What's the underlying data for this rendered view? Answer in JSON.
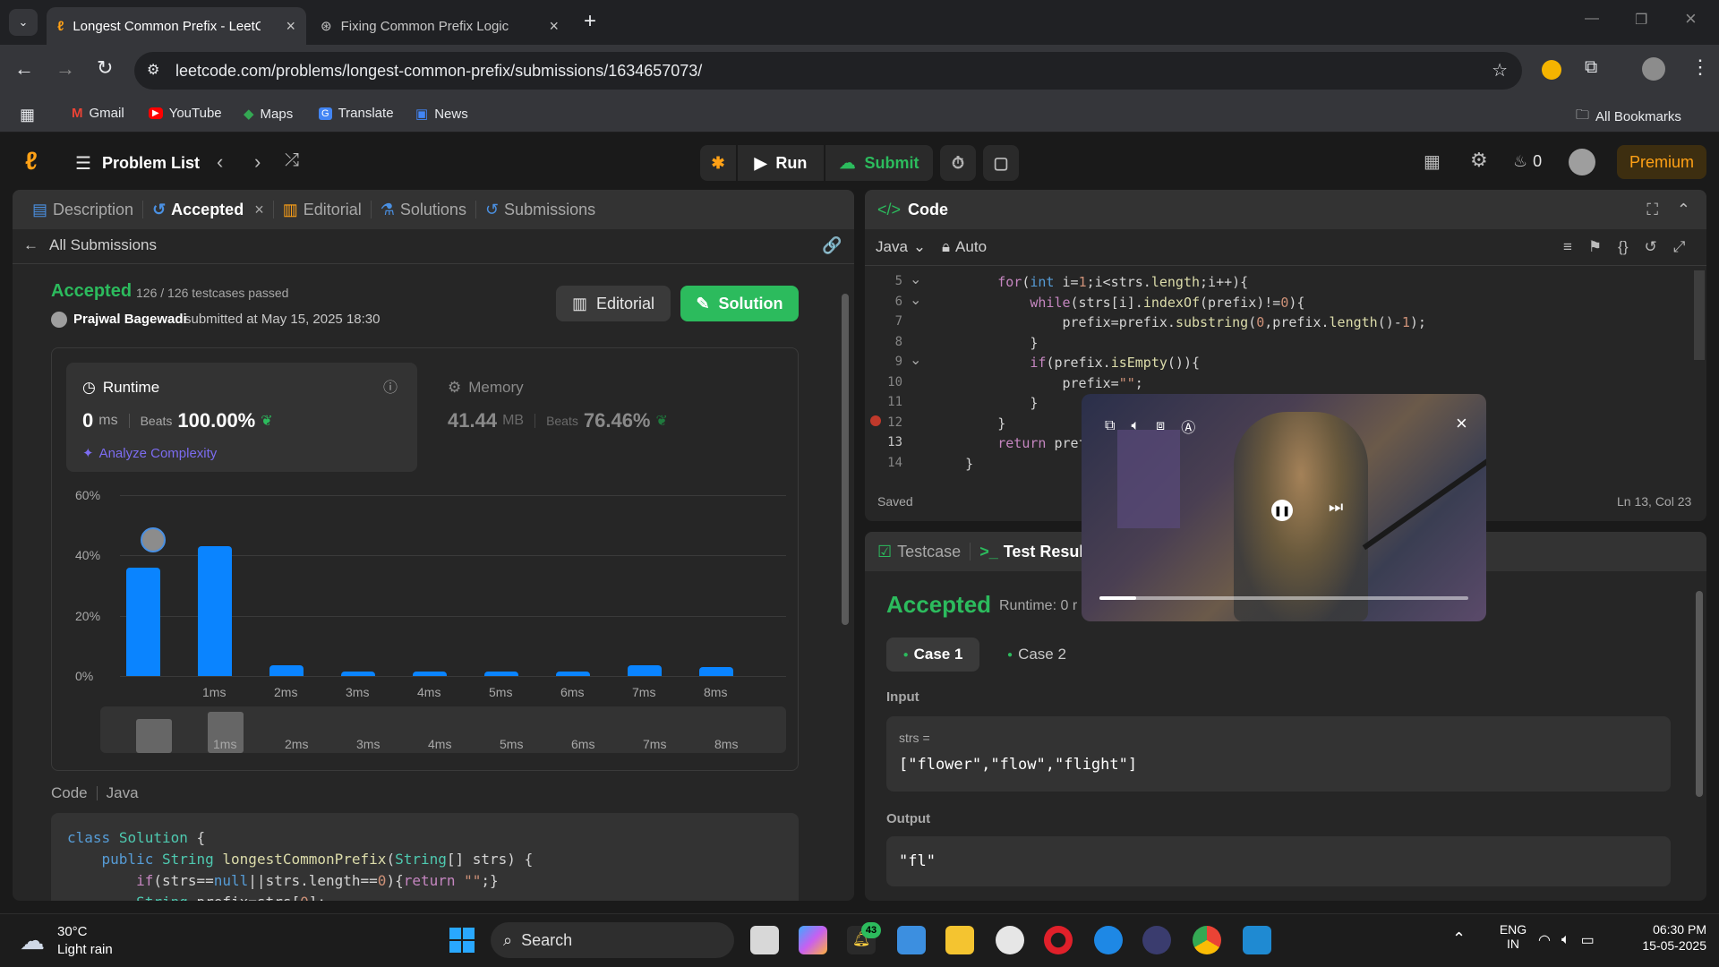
{
  "browser": {
    "tabs": [
      {
        "title": "Longest Common Prefix - LeetC"
      },
      {
        "title": "Fixing Common Prefix Logic"
      }
    ],
    "url": "leetcode.com/problems/longest-common-prefix/submissions/1634657073/",
    "bookmarks": [
      "Gmail",
      "YouTube",
      "Maps",
      "Translate",
      "News"
    ],
    "all_bookmarks": "All Bookmarks"
  },
  "nav": {
    "problem_list": "Problem List",
    "run": "Run",
    "submit": "Submit",
    "streak": "0",
    "premium": "Premium"
  },
  "left": {
    "tabs": [
      "Description",
      "Accepted",
      "Editorial",
      "Solutions",
      "Submissions"
    ],
    "all_submissions": "All Submissions",
    "status": "Accepted",
    "testcases": "126 / 126 testcases passed",
    "user": "Prajwal Bagewadi",
    "submitted": "submitted at May 15, 2025 18:30",
    "editorial_btn": "Editorial",
    "solution_btn": "Solution",
    "runtime": {
      "label": "Runtime",
      "value": "0",
      "unit": "ms",
      "beats_label": "Beats",
      "beats": "100.00%"
    },
    "analyze": "Analyze Complexity",
    "memory": {
      "label": "Memory",
      "value": "41.44",
      "unit": "MB",
      "beats_label": "Beats",
      "beats": "76.46%"
    },
    "code_label": "Code",
    "lang": "Java",
    "code_lines": [
      "class Solution {",
      "    public String longestCommonPrefix(String[] strs) {",
      "        if(strs==null||strs.length==0){return \"\";}",
      "        String prefix=strs[0];"
    ]
  },
  "chart_data": {
    "type": "bar",
    "yticks": [
      "60%",
      "40%",
      "20%",
      "0%"
    ],
    "ylim": [
      0,
      60
    ],
    "categories": [
      "",
      "1ms",
      "2ms",
      "3ms",
      "4ms",
      "5ms",
      "6ms",
      "7ms",
      "8ms"
    ],
    "values": [
      36,
      43,
      3.5,
      1.5,
      1.5,
      1.5,
      1.5,
      3.5,
      3
    ]
  },
  "editor": {
    "title": "Code",
    "lang": "Java",
    "mode": "Auto",
    "saved": "Saved",
    "cursor": "Ln 13, Col 23",
    "lines": [
      {
        "n": "5",
        "text": "        for(int i=1;i<strs.length;i++){"
      },
      {
        "n": "6",
        "text": "            while(strs[i].indexOf(prefix)!=0){"
      },
      {
        "n": "7",
        "text": "                prefix=prefix.substring(0,prefix.length()-1);"
      },
      {
        "n": "8",
        "text": "            }"
      },
      {
        "n": "9",
        "text": "            if(prefix.isEmpty()){"
      },
      {
        "n": "10",
        "text": "                prefix=\"\";"
      },
      {
        "n": "11",
        "text": "            }"
      },
      {
        "n": "12",
        "text": "        }"
      },
      {
        "n": "13",
        "text": "        return prefi"
      },
      {
        "n": "14",
        "text": "    }"
      }
    ]
  },
  "result": {
    "tabs": [
      "Testcase",
      "Test Result"
    ],
    "status": "Accepted",
    "runtime": "Runtime: 0 r",
    "cases": [
      "Case 1",
      "Case 2"
    ],
    "input_label": "Input",
    "var": "strs =",
    "input_value": "[\"flower\",\"flow\",\"flight\"]",
    "output_label": "Output",
    "output_value": "\"fl\""
  },
  "video": {
    "progress": 0.1
  },
  "taskbar": {
    "temp": "30°C",
    "weather": "Light rain",
    "search": "Search",
    "badge": "43",
    "lang1": "ENG",
    "lang2": "IN",
    "time": "06:30 PM",
    "date": "15-05-2025"
  }
}
